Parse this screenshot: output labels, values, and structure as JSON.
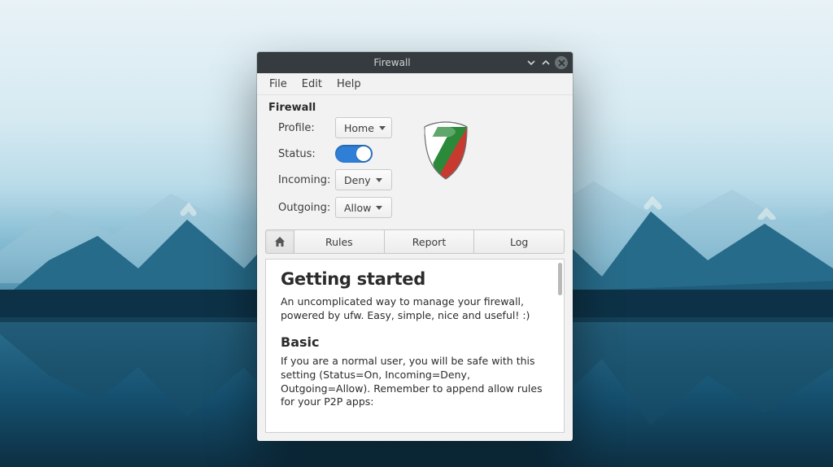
{
  "window": {
    "title": "Firewall"
  },
  "menubar": {
    "file": "File",
    "edit": "Edit",
    "help": "Help"
  },
  "heading": "Firewall",
  "settings": {
    "profile_label": "Profile:",
    "profile_value": "Home",
    "status_label": "Status:",
    "status_on": true,
    "incoming_label": "Incoming:",
    "incoming_value": "Deny",
    "outgoing_label": "Outgoing:",
    "outgoing_value": "Allow"
  },
  "icons": {
    "home": "home-icon",
    "shield": "gufw-shield-icon"
  },
  "tabs": {
    "home": "",
    "rules": "Rules",
    "report": "Report",
    "log": "Log"
  },
  "doc": {
    "h1": "Getting started",
    "p1": "An uncomplicated way to manage your firewall, powered by ufw. Easy, simple, nice and useful! :)",
    "h2": "Basic",
    "p2": "If you are a normal user, you will be safe with this setting (Status=On, Incoming=Deny, Outgoing=Allow). Remember to append allow rules for your P2P apps:"
  },
  "colors": {
    "accent": "#2f7fd7",
    "titlebar": "#353b3e"
  }
}
